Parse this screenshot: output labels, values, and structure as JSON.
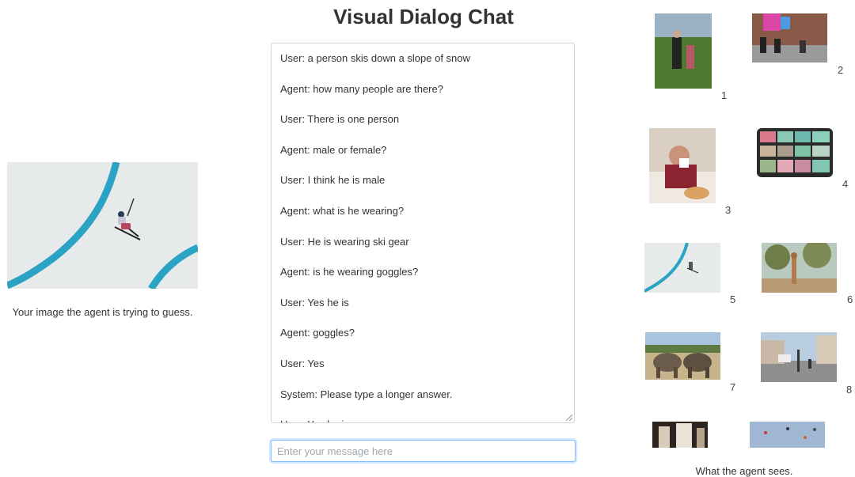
{
  "page": {
    "title": "Visual Dialog Chat"
  },
  "target": {
    "caption": "Your image the agent is trying to guess."
  },
  "chat": {
    "messages": [
      "User: a person skis down a slope of snow",
      "Agent: how many people are there?",
      "User: There is one person",
      "Agent: male or female?",
      "User: I think he is male",
      "Agent: what is he wearing?",
      "User: He is wearing ski gear",
      "Agent: is he wearing goggles?",
      "User: Yes he is",
      "Agent: goggles?",
      "User: Yes",
      "System: Please type a longer answer.",
      "User: Yes he is"
    ],
    "input_placeholder": "Enter your message here",
    "input_value": ""
  },
  "gallery": {
    "caption": "What the agent sees.",
    "items": [
      {
        "number": "1"
      },
      {
        "number": "2"
      },
      {
        "number": "3"
      },
      {
        "number": "4"
      },
      {
        "number": "5"
      },
      {
        "number": "6"
      },
      {
        "number": "7"
      },
      {
        "number": "8"
      },
      {
        "number": ""
      },
      {
        "number": ""
      }
    ]
  },
  "colors": {
    "ski_line": "#2aa3c4",
    "snow": "#e6e9ea",
    "input_focus": "#80bdff"
  }
}
